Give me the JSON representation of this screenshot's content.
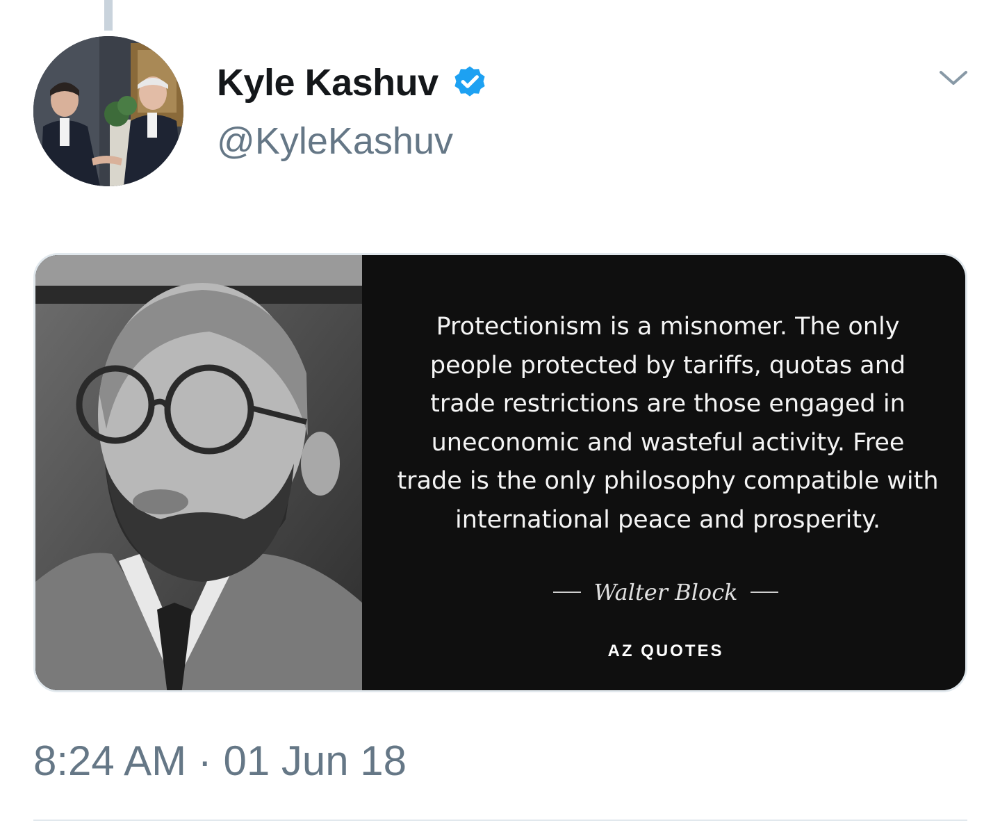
{
  "tweet": {
    "author": {
      "display_name": "Kyle Kashuv",
      "handle": "@KyleKashuv",
      "verified": true,
      "avatar_icon": "avatar-photo"
    },
    "menu_icon": "chevron-down-icon",
    "media": {
      "quote": "Protectionism is a misnomer. The only people protected by tariffs, quotas and trade restrictions are those engaged in uneconomic and wasteful activity. Free trade is the only philosophy compatible with international peace and prosperity.",
      "attribution": "Walter Block",
      "brand": "AZ QUOTES"
    },
    "timestamp": "8:24 AM · 01 Jun 18"
  },
  "colors": {
    "name": "#14171a",
    "secondary": "#657786",
    "verified_blue": "#1da1f2",
    "divider": "#e1e8ed",
    "quote_bg": "#0f0f0f"
  }
}
